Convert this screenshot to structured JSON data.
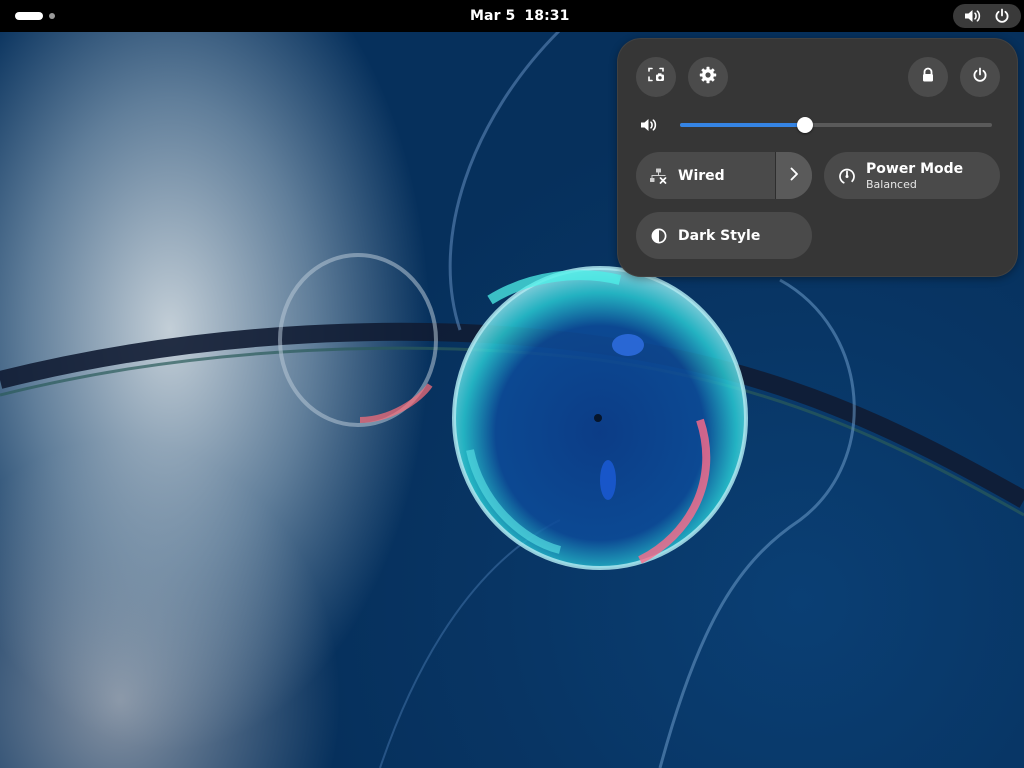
{
  "topbar": {
    "date": "Mar 5",
    "time": "18:31",
    "status_icons": [
      "volume-icon",
      "power-icon"
    ]
  },
  "quick_settings": {
    "buttons": [
      "screenshot-icon",
      "settings-gear-icon",
      "lock-icon",
      "power-icon"
    ],
    "volume": {
      "level": 0.4,
      "icon": "volume-icon"
    },
    "toggles": {
      "wired": {
        "title": "Wired",
        "icon": "wired-network-disconnected-icon"
      },
      "power_mode": {
        "title": "Power Mode",
        "subtitle": "Balanced",
        "icon": "power-mode-gauge-icon"
      },
      "dark_style": {
        "title": "Dark Style",
        "icon": "dark-style-icon"
      }
    }
  },
  "colors": {
    "accent": "#3584e4",
    "panel": "#363636",
    "button": "#4b4b4b",
    "topbar": "#000000"
  }
}
